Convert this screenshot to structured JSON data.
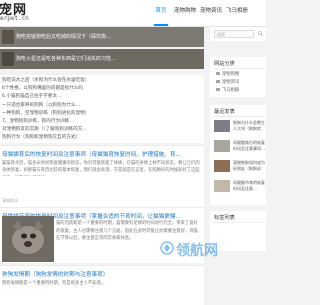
{
  "site": {
    "logo_main": "宠网",
    "logo_sub": "erpet.cn"
  },
  "nav": [
    "首页",
    "宠物购物",
    "宠物资讯",
    "飞马相册"
  ],
  "featured": [
    "狗吃完饭狗吃后又吃掉的情况下（探究狗…",
    "狗吃火星还是吃各种东西是它们消失的习性…"
  ],
  "list_items": [
    "狗吃白水之后（水狗为什么会在水里吃饭）",
    "6个性格，以狗狗嘴里的问题是指什么吗",
    "6.小猫狗猫自己住子不要太…",
    "一只适合家养的狗狗（以狗狗为什么…",
    "一种狗狗，空宠物训练（狗狗进化的宠物）",
    "7、宠物狗狗训练，狗的行为训练…",
    "对宠物狗友的实施（（了解狗狗训练的方…",
    "狗狗行为（狗狗和宠物狗交互的方式）"
  ],
  "articles": [
    {
      "title": "母猫猫育后的恢复时间及注意事项（母猫猫育恢复时间、护理措施、育…",
      "excerpt": "猫猫育术后，猫多长时间恢复健康的状态，你对可能恢复了体质，在猫的身体上并不同状态，要让它们的身体恢复，如果猫在育后比较的基本恢复，我们就会处理，于是就是在这里，在照顾好的时候就好了这些工作，给我们也就很好。",
      "meta": "宠物资讯"
    },
    {
      "title": "母猫猫节育的恢复时间及注意事项（掌握合适的节育时间，让猫猫更健…",
      "text": "猫的活跃期是一个重要的时期，猫需要有足够的时间进行完全，带来了良好的恢复，主人也需要注意几个方面，因此在此时可能让你需要注意好，母猫在节育以后，要注意正常的饮食和休息。",
      "meta": "宠物资讯"
    },
    {
      "title": "狗狗发情期（狗狗发情的时期与注意事项）",
      "text": "狗狗发情期是一个重要的时期，但是很多主人不知道。",
      "meta": ""
    }
  ],
  "sidebar": {
    "search_placeholder": "搜索",
    "categories_title": "网站分类",
    "categories": [
      "宠物购物",
      "宠物资讯",
      "飞马相册"
    ],
    "recent_title": "最近发表",
    "recent": [
      "狗狗为什么会朝主人大叫（狗狗吠叫…",
      "母猫猫育后的恢复时间及注意事项…",
      "宠物狗狗如何成为好朋友（狗狗训练…",
      "母猫猫节育的恢复时间及注意…"
    ],
    "tags_title": "标签列表"
  },
  "watermark": "领航网"
}
